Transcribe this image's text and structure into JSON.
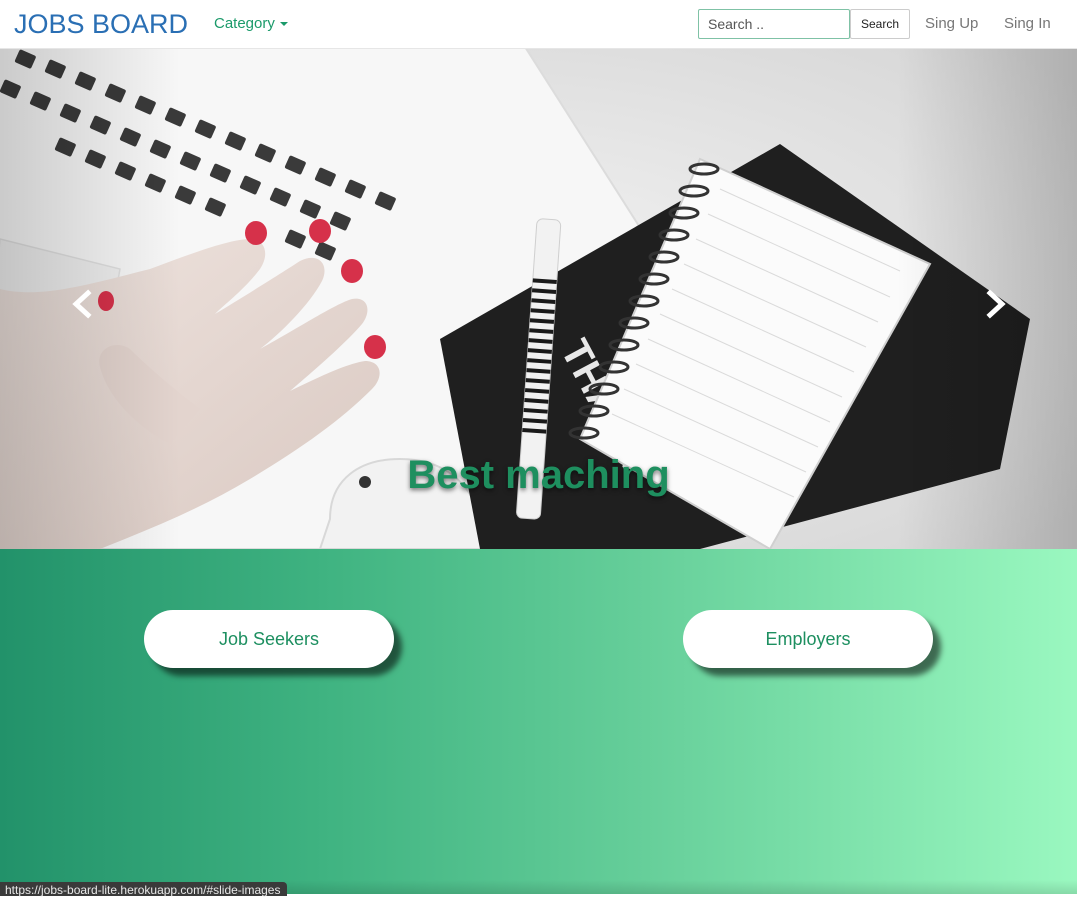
{
  "navbar": {
    "brand": "JOBS BOARD",
    "category_label": "Category",
    "search_placeholder": "Search ..",
    "search_button": "Search",
    "signup": "Sing Up",
    "signin": "Sing In"
  },
  "carousel": {
    "caption": "Best maching",
    "prev_icon": "chevron-left-icon",
    "next_icon": "chevron-right-icon"
  },
  "actions": {
    "job_seekers": "Job Seekers",
    "employers": "Employers"
  },
  "status_bar": {
    "url": "https://jobs-board-lite.herokuapp.com/#slide-images"
  },
  "colors": {
    "brand": "#2a6fb4",
    "accent_green": "#1b9a6a",
    "gradient_start": "#22926a",
    "gradient_end": "#9af8c0"
  }
}
